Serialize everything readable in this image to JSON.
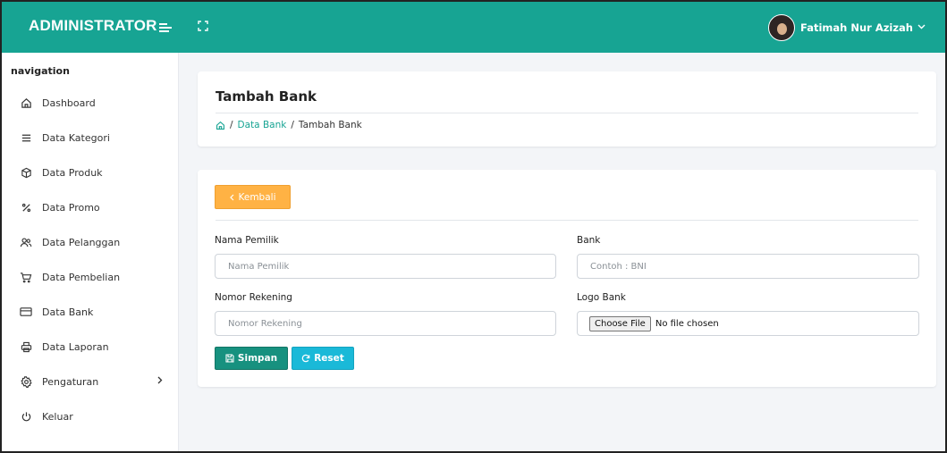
{
  "header": {
    "brand": "ADMINISTRATOR",
    "user_name": "Fatimah Nur Azizah",
    "accent_color": "#17a493"
  },
  "sidebar": {
    "title": "navigation",
    "items": [
      {
        "label": "Dashboard",
        "icon": "home-icon"
      },
      {
        "label": "Data Kategori",
        "icon": "list-icon"
      },
      {
        "label": "Data Produk",
        "icon": "box-icon"
      },
      {
        "label": "Data Promo",
        "icon": "percent-icon"
      },
      {
        "label": "Data Pelanggan",
        "icon": "users-icon"
      },
      {
        "label": "Data Pembelian",
        "icon": "cart-icon"
      },
      {
        "label": "Data Bank",
        "icon": "credit-card-icon"
      },
      {
        "label": "Data Laporan",
        "icon": "printer-icon"
      },
      {
        "label": "Pengaturan",
        "icon": "settings-icon"
      },
      {
        "label": "Keluar",
        "icon": "power-icon"
      }
    ]
  },
  "page": {
    "title": "Tambah Bank",
    "breadcrumb": {
      "parent": "Data Bank",
      "current": "Tambah Bank"
    }
  },
  "form": {
    "back_label": "Kembali",
    "owner_label": "Nama Pemilik",
    "owner_placeholder": "Nama Pemilik",
    "bank_label": "Bank",
    "bank_placeholder": "Contoh : BNI",
    "account_label": "Nomor Rekening",
    "account_placeholder": "Nomor Rekening",
    "logo_label": "Logo Bank",
    "file_button": "Choose File",
    "file_status": "No file chosen",
    "save_label": "Simpan",
    "reset_label": "Reset"
  }
}
